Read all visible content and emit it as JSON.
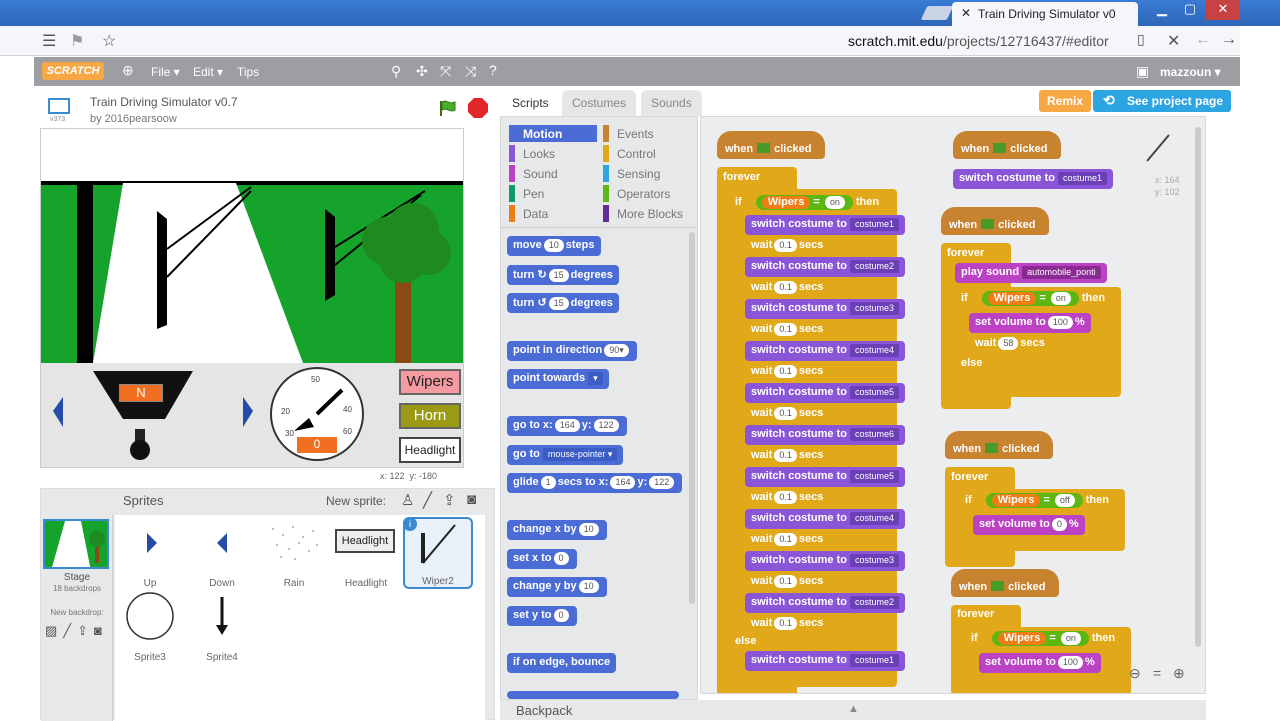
{
  "browser": {
    "tab_title": "Train Driving Simulator v0",
    "url_domain": "scratch.mit.edu",
    "url_path": "/projects/12716437/#editor"
  },
  "menubar": {
    "logo": "SCRATCH",
    "file": "File ▾",
    "edit": "Edit ▾",
    "tips": "Tips",
    "user": "mazzoun ▾"
  },
  "project": {
    "title": "Train Driving Simulator v0.7",
    "author": "by 2016pearsoow",
    "version_badge": "v373"
  },
  "stage": {
    "gear": "N",
    "speed": "0",
    "buttons": [
      "Wipers",
      "Horn",
      "Headlight"
    ],
    "button_colors": [
      "#f59aa0",
      "#9a9a14",
      "#ffffff"
    ],
    "mouse_x": "x: 122",
    "mouse_y": "y: -180",
    "gauge_ticks": [
      "50",
      "40",
      "60",
      "20",
      "30"
    ]
  },
  "sprites_pane": {
    "header": "Sprites",
    "new_sprite": "New sprite:",
    "stage_label": "Stage",
    "stage_sub": "18 backdrops",
    "new_backdrop": "New backdrop:",
    "sprites": [
      "Up",
      "Down",
      "Rain",
      "Headlight",
      "Wiper2",
      "Sprite3",
      "Sprite4"
    ],
    "headlight_text": "Headlight"
  },
  "tabs": [
    "Scripts",
    "Costumes",
    "Sounds"
  ],
  "buttons": {
    "remix": "Remix",
    "see_page": "See project page"
  },
  "categories_left": [
    "Motion",
    "Looks",
    "Sound",
    "Pen",
    "Data"
  ],
  "categories_right": [
    "Events",
    "Control",
    "Sensing",
    "Operators",
    "More Blocks"
  ],
  "category_colors": [
    "#4a6cd4",
    "#8a55d7",
    "#bb42c3",
    "#0e9a6c",
    "#ee7d16",
    "#c88330",
    "#e1a91a",
    "#2ca5e2",
    "#5cb712",
    "#632d99"
  ],
  "palette": {
    "move": "move",
    "move_n": "10",
    "move_t": "steps",
    "turn_r": "turn ↻",
    "turn_l": "turn ↺",
    "deg_n": "15",
    "deg_t": "degrees",
    "point_dir": "point in direction",
    "point_dir_v": "90▾",
    "point_towards": "point towards",
    "point_towards_v": "▾",
    "goto": "go to x:",
    "goto_x": "164",
    "goto_y_lbl": "y:",
    "goto_y": "122",
    "goto_mp": "go to",
    "goto_mp_v": "mouse-pointer ▾",
    "glide": "glide",
    "glide_n": "1",
    "glide_t": "secs to x:",
    "glide_x": "164",
    "glide_y": "122",
    "change_x": "change x by",
    "change_x_n": "10",
    "set_x": "set x to",
    "set_x_n": "0",
    "change_y": "change y by",
    "change_y_n": "10",
    "set_y": "set y to",
    "set_y_n": "0",
    "bounce": "if on edge, bounce"
  },
  "scripts": {
    "when": "when",
    "clicked": "clicked",
    "forever": "forever",
    "if": "if",
    "then": "then",
    "else": "else",
    "wipers": "Wipers",
    "on": "on",
    "off": "off",
    "eq": "=",
    "switch": "switch costume to",
    "wait": "wait",
    "secs": "secs",
    "wait_v": "0.1",
    "costumes": [
      "costume1",
      "costume2",
      "costume3",
      "costume4",
      "costume5",
      "costume6",
      "costume5",
      "costume4",
      "costume3",
      "costume2"
    ],
    "else_costume": "costume1",
    "s2_costume": "costume1",
    "play_sound": "play sound",
    "sound_name": "automobile_ponti",
    "set_volume": "set volume to",
    "vol100": "100",
    "vol0": "0",
    "pct": "%",
    "wait58": "58",
    "mouse_x": "x: 164",
    "mouse_y": "y: 102"
  },
  "backpack": "Backpack"
}
